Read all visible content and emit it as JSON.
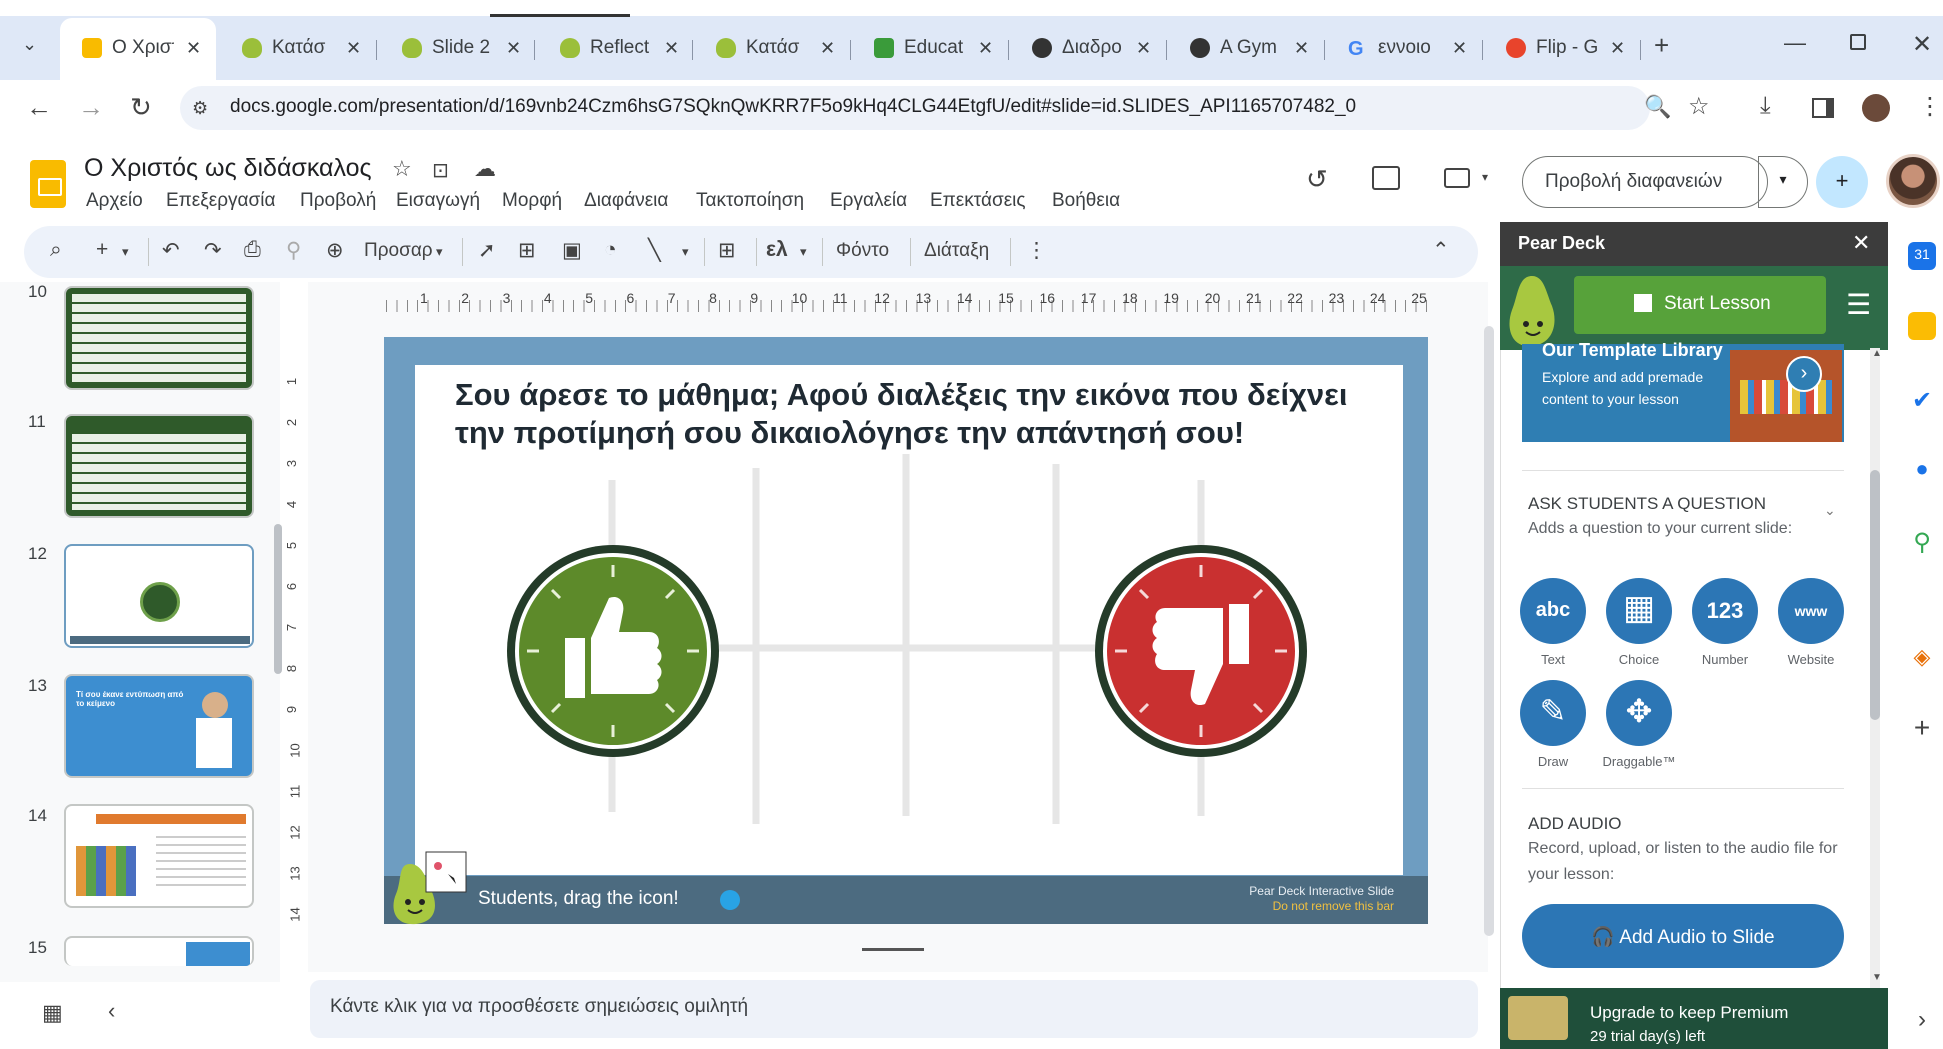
{
  "browser": {
    "tabs": [
      {
        "title": "Ο Χριστ",
        "favicon": "slides-icon",
        "color": "#f9bb00"
      },
      {
        "title": "Κατάσ",
        "favicon": "pear-icon",
        "color": "#9bbf3a"
      },
      {
        "title": "Slide 2",
        "favicon": "pear-icon",
        "color": "#9bbf3a"
      },
      {
        "title": "Reflect",
        "favicon": "pear-icon",
        "color": "#9bbf3a"
      },
      {
        "title": "Κατάσ",
        "favicon": "pear-icon",
        "color": "#9bbf3a"
      },
      {
        "title": "Educat",
        "favicon": "edu-icon",
        "color": "#3a9b3a"
      },
      {
        "title": "Διαδρο",
        "favicon": "circle-icon",
        "color": "#333333"
      },
      {
        "title": "A Gym",
        "favicon": "github-icon",
        "color": "#333333"
      },
      {
        "title": "εννοιο",
        "favicon": "google-icon",
        "color": "#4285f4"
      },
      {
        "title": "Flip - G",
        "favicon": "flip-icon",
        "color": "#e8442c"
      }
    ],
    "url": "docs.google.com/presentation/d/169vnb24Czm6hsG7SQknQwKRR7F5o9kHq4CLG44EtgfU/edit#slide=id.SLIDES_API1165707482_0"
  },
  "doc": {
    "title": "Ο Χριστός ως διδάσκαλος",
    "menu": [
      "Αρχείο",
      "Επεξεργασία",
      "Προβολή",
      "Εισαγωγή",
      "Μορφή",
      "Διαφάνεια",
      "Τακτοποίηση",
      "Εργαλεία",
      "Επεκτάσεις",
      "Βοήθεια"
    ],
    "slideshow_label": "Προβολή διαφανειών",
    "toolbar": {
      "zoom_label": "Προσαρ",
      "background_label": "Φόντο",
      "layout_label": "Διάταξη"
    }
  },
  "filmstrip": {
    "numbers": [
      "10",
      "11",
      "12",
      "13",
      "14",
      "15"
    ],
    "thumb13_text": "Τί σου έκανε εντύπωση από το κείμενο"
  },
  "ruler": {
    "marks": [
      "1",
      "2",
      "3",
      "4",
      "5",
      "6",
      "7",
      "8",
      "9",
      "10",
      "11",
      "12",
      "13",
      "14",
      "15",
      "16",
      "17",
      "18",
      "19",
      "20",
      "21",
      "22",
      "23",
      "24",
      "25"
    ],
    "vmarks": [
      "1",
      "2",
      "3",
      "4",
      "5",
      "6",
      "7",
      "8",
      "9",
      "10",
      "11",
      "12",
      "13",
      "14"
    ]
  },
  "slide": {
    "title": "Σου άρεσε το μάθημα; Αφού διαλέξεις την εικόνα που δείχνει την προτίμησή σου δικαιολόγησε την απάντησή σου!",
    "bar_text": "Students, drag the icon!",
    "bar_right_1": "Pear Deck Interactive Slide",
    "bar_right_2": "Do not remove this bar"
  },
  "notes": {
    "placeholder": "Κάντε κλικ για να προσθέσετε σημειώσεις ομιλητή"
  },
  "pear_deck": {
    "header": "Pear Deck",
    "start_lesson": "Start Lesson",
    "template_title": "Our Template Library",
    "template_desc": "Explore and add premade content to your lesson",
    "ask_title": "ASK STUDENTS A QUESTION",
    "ask_desc": "Adds a question to your current slide:",
    "question_types": [
      {
        "icon": "abc",
        "label": "Text"
      },
      {
        "icon": "▦",
        "label": "Choice"
      },
      {
        "icon": "123",
        "label": "Number"
      },
      {
        "icon": "www",
        "label": "Website"
      },
      {
        "icon": "✎",
        "label": "Draw"
      },
      {
        "icon": "✥",
        "label": "Draggable™"
      }
    ],
    "audio_title": "ADD AUDIO",
    "audio_desc": "Record, upload, or listen to the audio file for your lesson:",
    "audio_button": "Add Audio to Slide",
    "upgrade_title": "Upgrade to keep Premium",
    "upgrade_desc": "29 trial day(s) left"
  }
}
